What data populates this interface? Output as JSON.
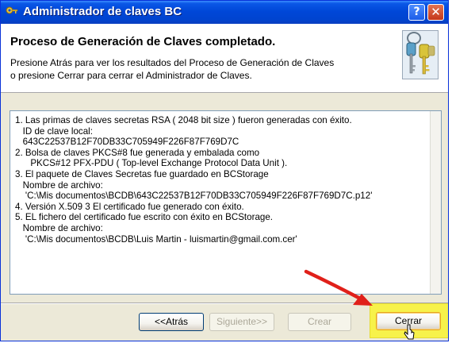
{
  "window": {
    "title": "Administrador de claves BC",
    "help_glyph": "?",
    "close_glyph": "✕"
  },
  "header": {
    "title": "Proceso de Generación de Claves completado.",
    "line1": "Presione Atrás para ver los resultados del Proceso de Generación de Claves",
    "line2": "o presione Cerrar para cerrar el Administrador de Claves."
  },
  "results": {
    "lines": [
      "1. Las primas de claves secretas RSA ( 2048 bit size ) fueron generadas con éxito.",
      "   ID de clave local:",
      "   643C22537B12F70DB33C705949F226F87F769D7C",
      "2. Bolsa de claves PKCS#8 fue generada y embalada como",
      "      PKCS#12 PFX-PDU ( Top-level Exchange Protocol Data Unit ).",
      "3. El paquete de Claves Secretas fue guardado en BCStorage",
      "   Nombre de archivo:",
      "    'C:\\Mis documentos\\BCDB\\643C22537B12F70DB33C705949F226F87F769D7C.p12'",
      "4. Versión X.509 3 El certificado fue generado con éxito.",
      "5. EL fichero del certificado fue escrito con éxito en BCStorage.",
      "   Nombre de archivo:",
      "    'C:\\Mis documentos\\BCDB\\Luis Martin - luismartin@gmail.com.cer'"
    ]
  },
  "buttons": {
    "back": "<<Atrás",
    "next": "Siguiente>>",
    "create": "Crear",
    "close": "Cerrar"
  }
}
